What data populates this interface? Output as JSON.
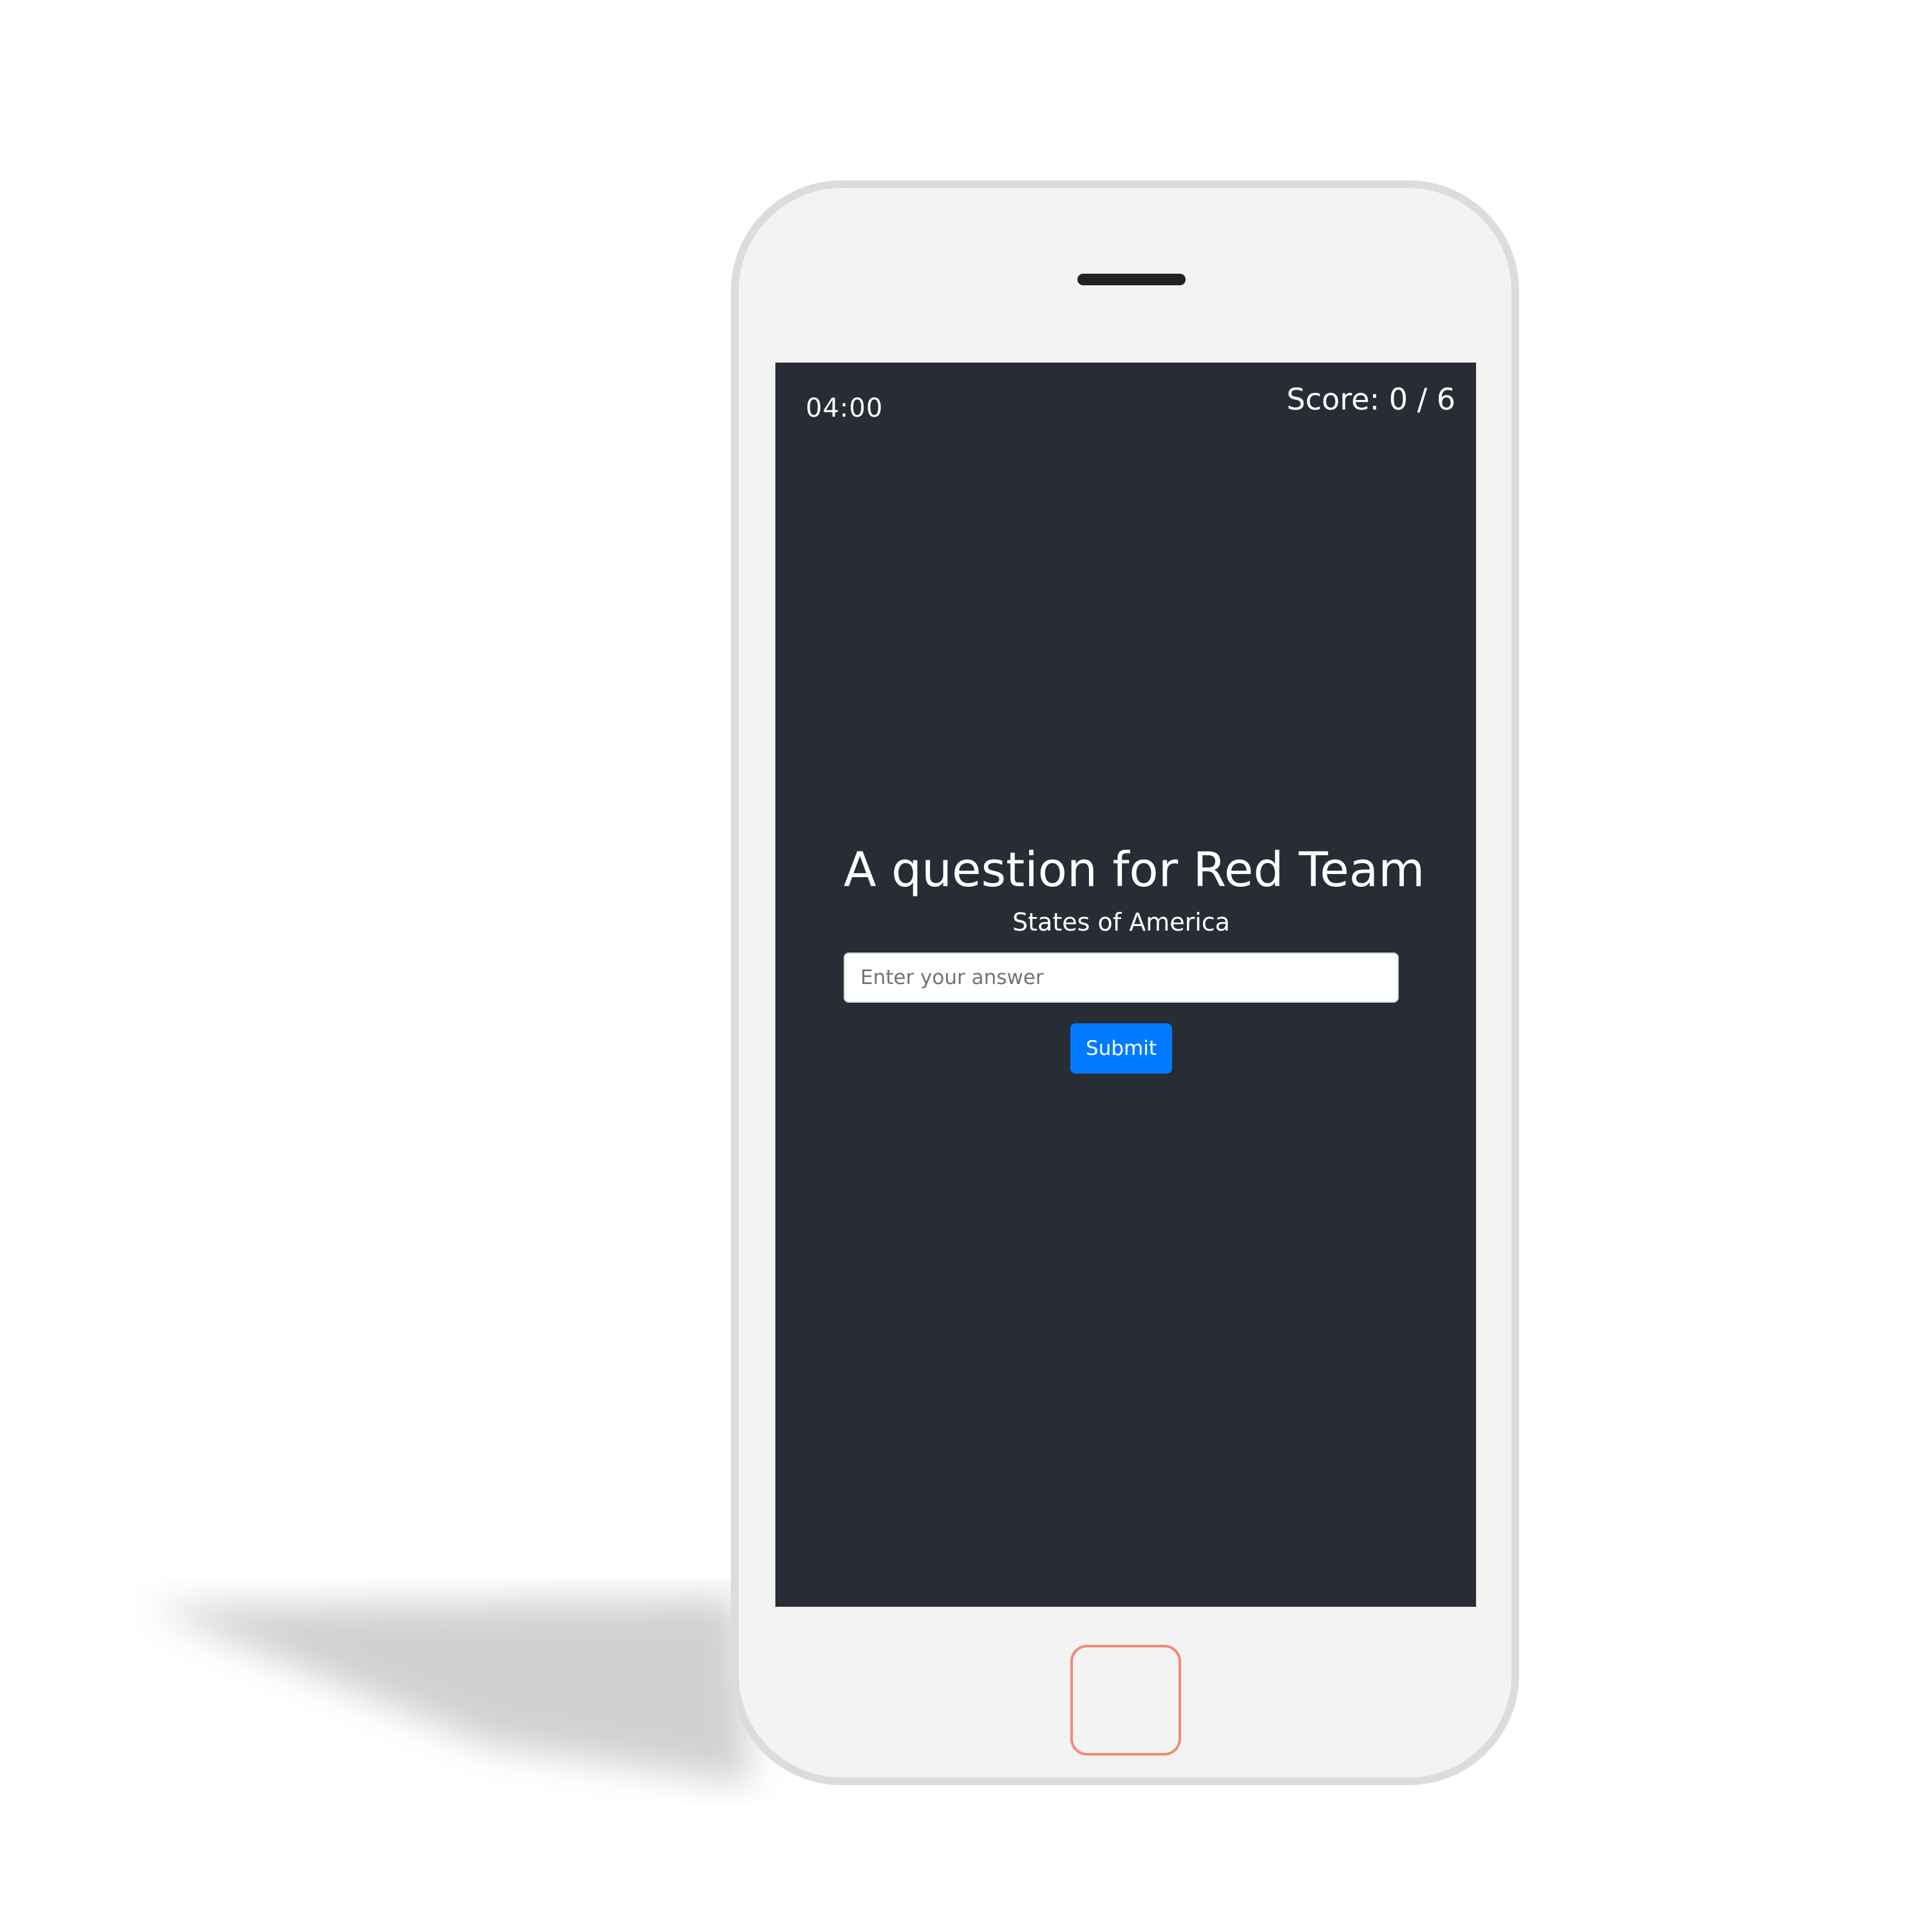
{
  "timer": {
    "remaining": "04:00"
  },
  "score": {
    "text": "Score: 0 / 6"
  },
  "question": {
    "title": "A question for Red Team",
    "text": "States of America"
  },
  "answer": {
    "value": "",
    "placeholder": "Enter your answer"
  },
  "actions": {
    "submit_label": "Submit"
  },
  "colors": {
    "screen_background": "#282c34",
    "submit_button": "#007bff",
    "home_button_border": "#f08a78",
    "device_body": "#f4f3f3"
  }
}
